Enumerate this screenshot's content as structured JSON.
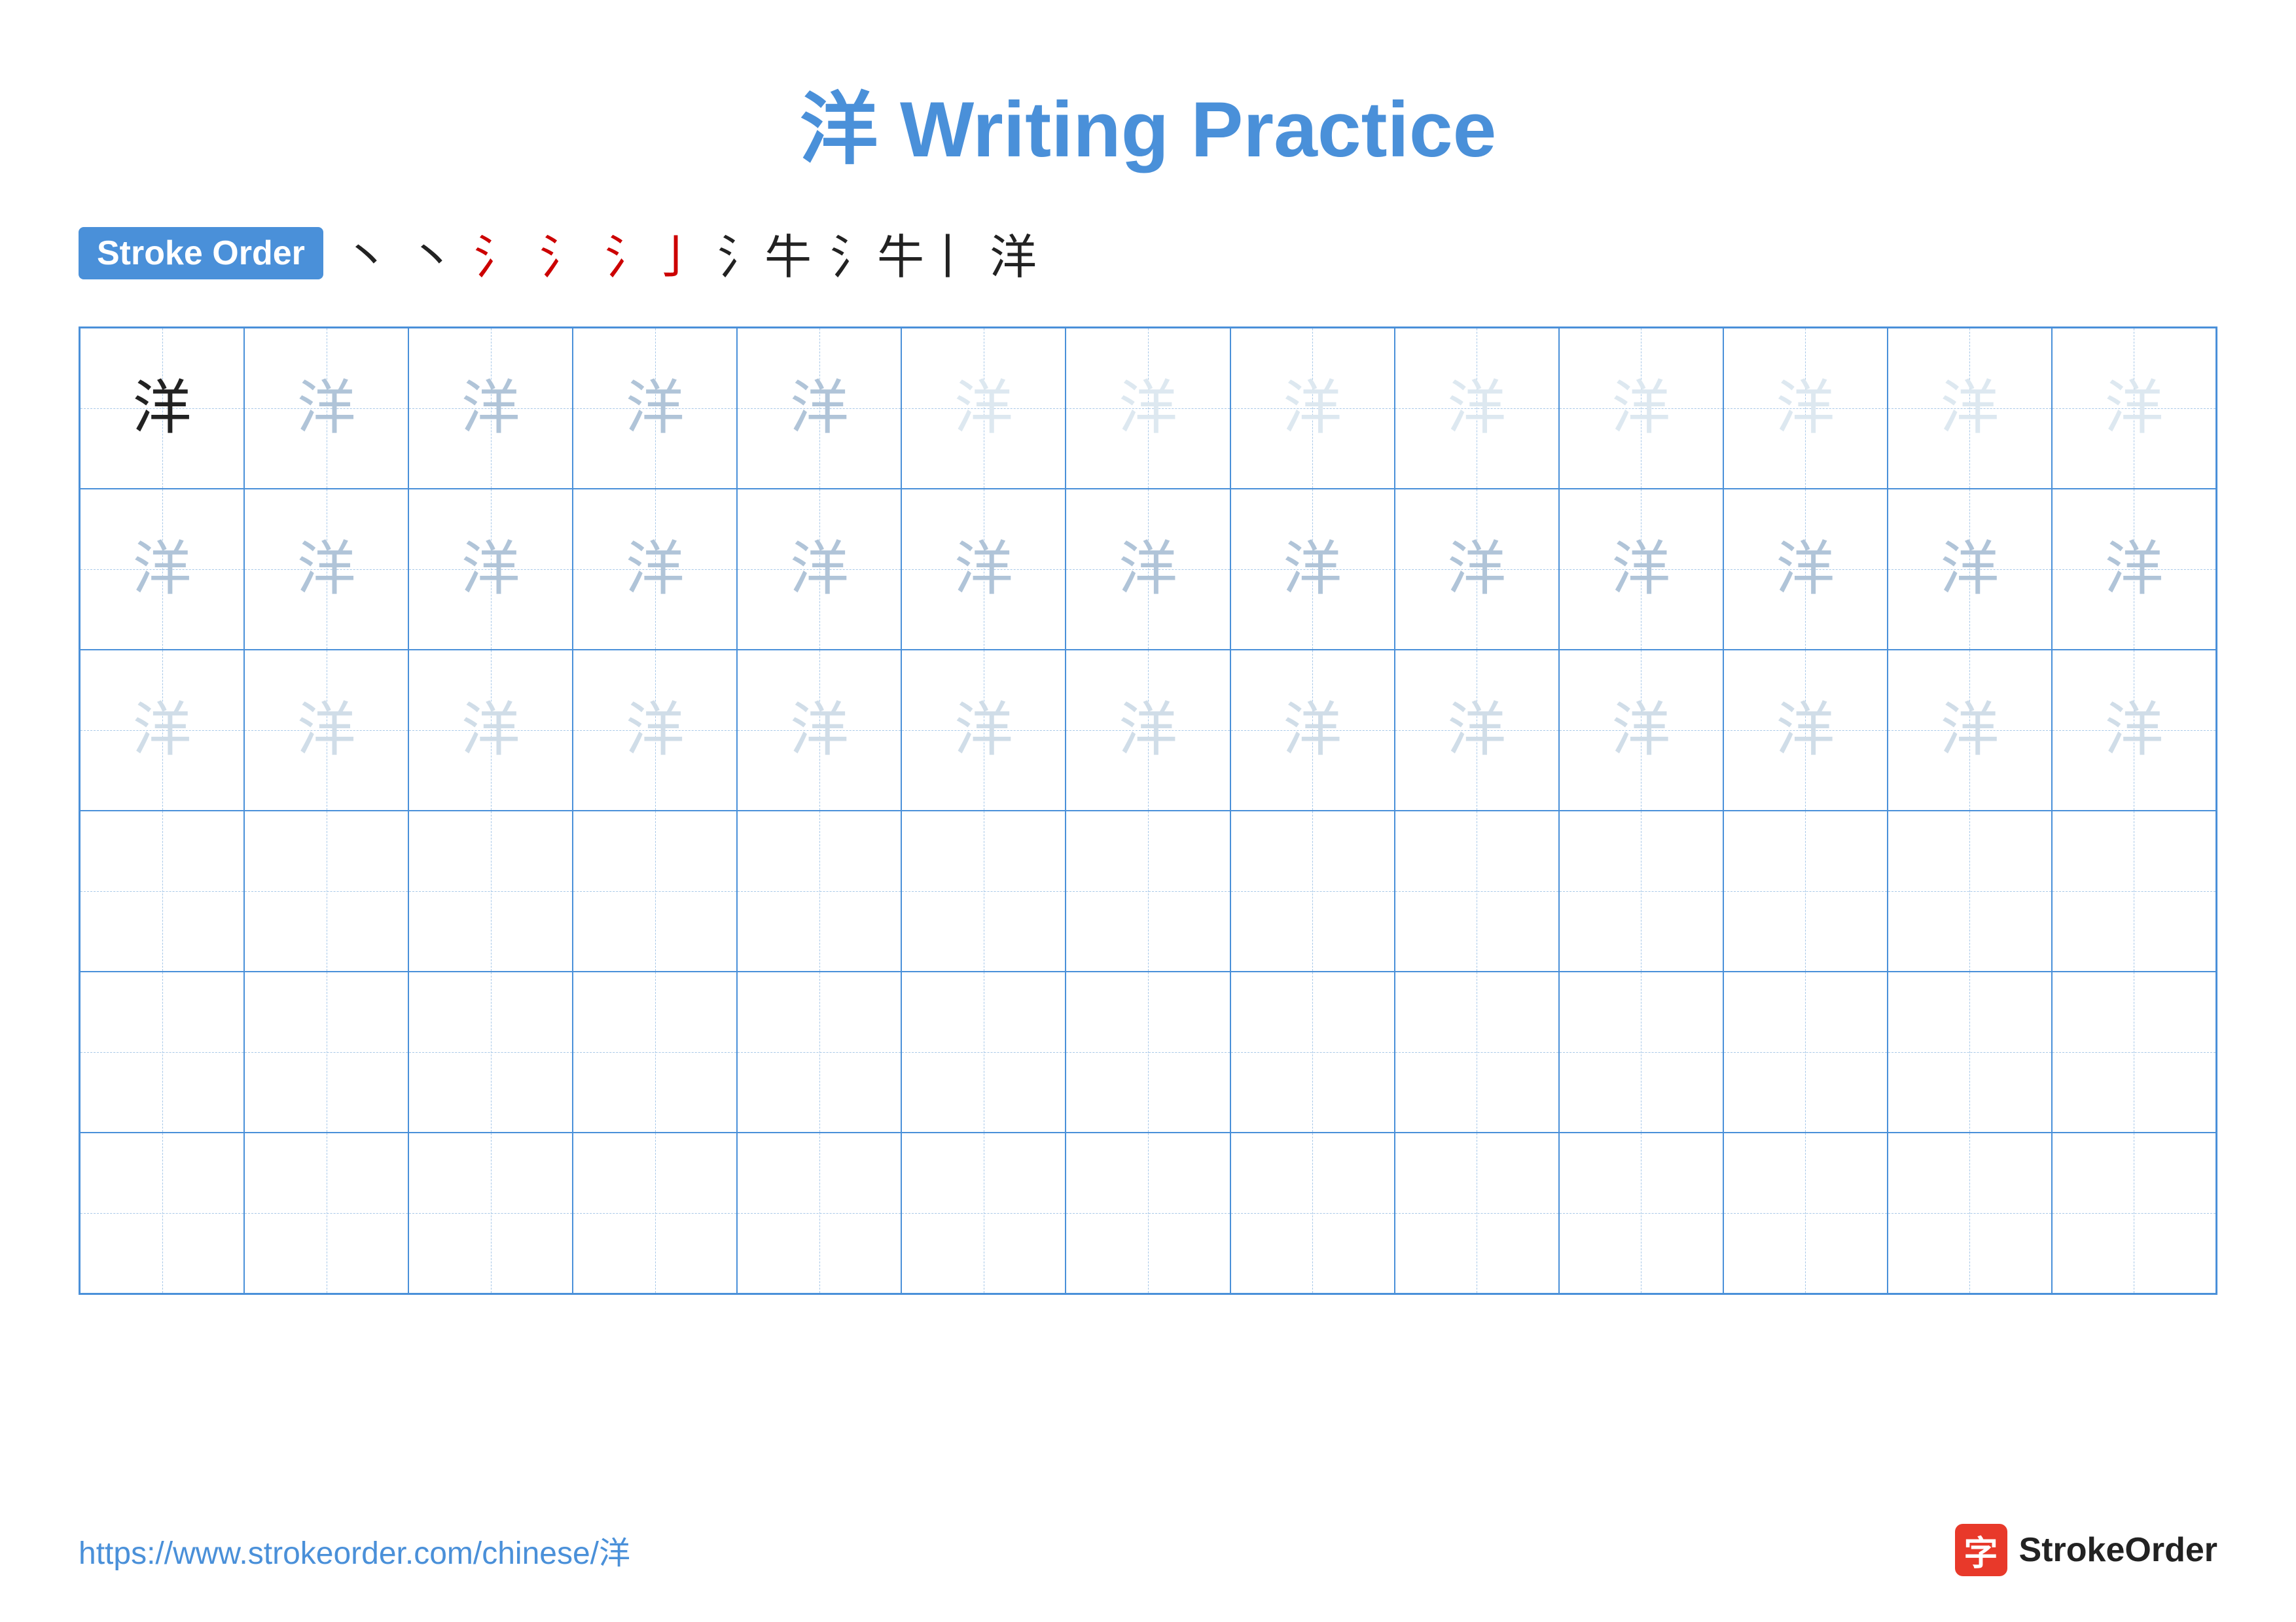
{
  "title": {
    "char": "洋",
    "text": "Writing Practice",
    "full": "洋 Writing Practice"
  },
  "stroke_order": {
    "badge_label": "Stroke Order",
    "steps": [
      "丶",
      "丶",
      "氵",
      "氵",
      "氵亅",
      "氵牛",
      "氵牛丨",
      "洋"
    ]
  },
  "grid": {
    "cols": 13,
    "rows": 6,
    "char": "洋",
    "row_styles": [
      "dark",
      "medium",
      "light",
      "empty",
      "empty",
      "empty"
    ]
  },
  "footer": {
    "url": "https://www.strokeorder.com/chinese/洋",
    "logo_char": "字",
    "logo_text": "StrokeOrder"
  }
}
